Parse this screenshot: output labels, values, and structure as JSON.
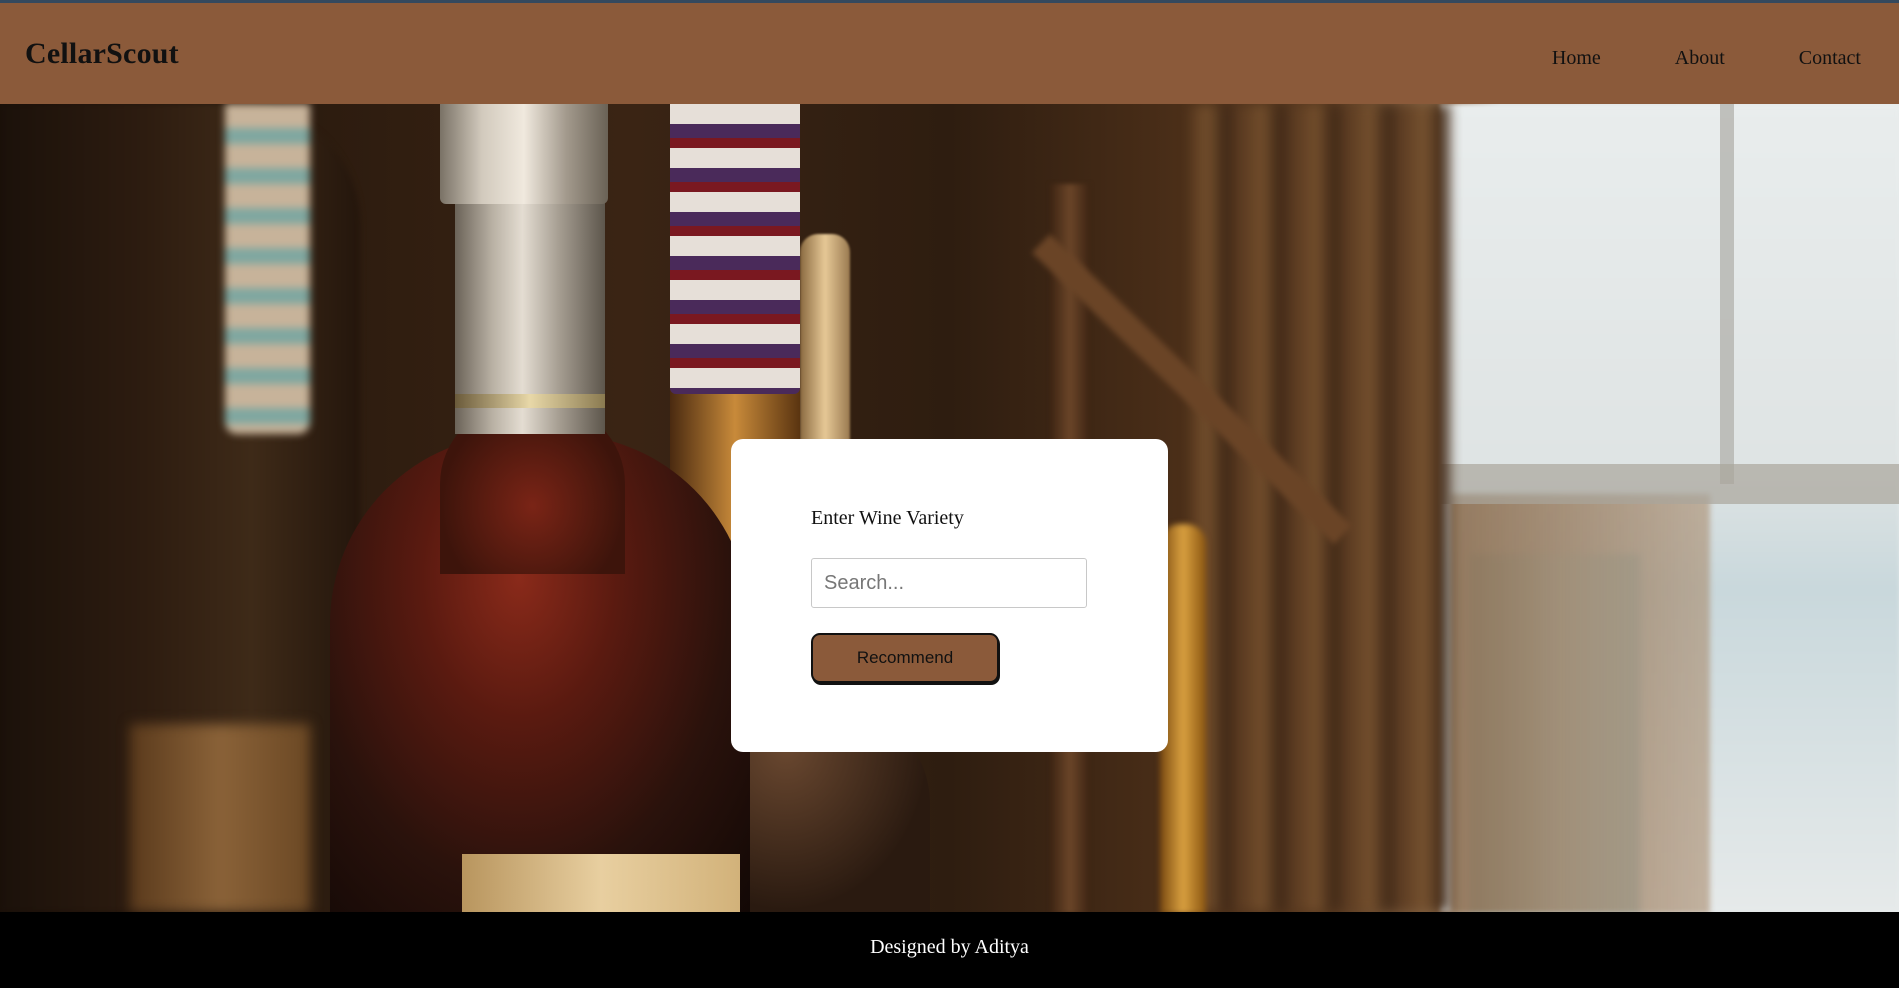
{
  "header": {
    "brand": "CellarScout",
    "nav": [
      {
        "label": "Home"
      },
      {
        "label": "About"
      },
      {
        "label": "Contact"
      }
    ]
  },
  "search_card": {
    "label": "Enter Wine Variety",
    "input_value": "",
    "input_placeholder": "Search...",
    "button_label": "Recommend"
  },
  "footer": {
    "text": "Designed by Aditya"
  },
  "colors": {
    "header_bg": "#8b5a3a",
    "button_bg": "#8b5a3a",
    "footer_bg": "#000000",
    "card_bg": "#ffffff"
  }
}
